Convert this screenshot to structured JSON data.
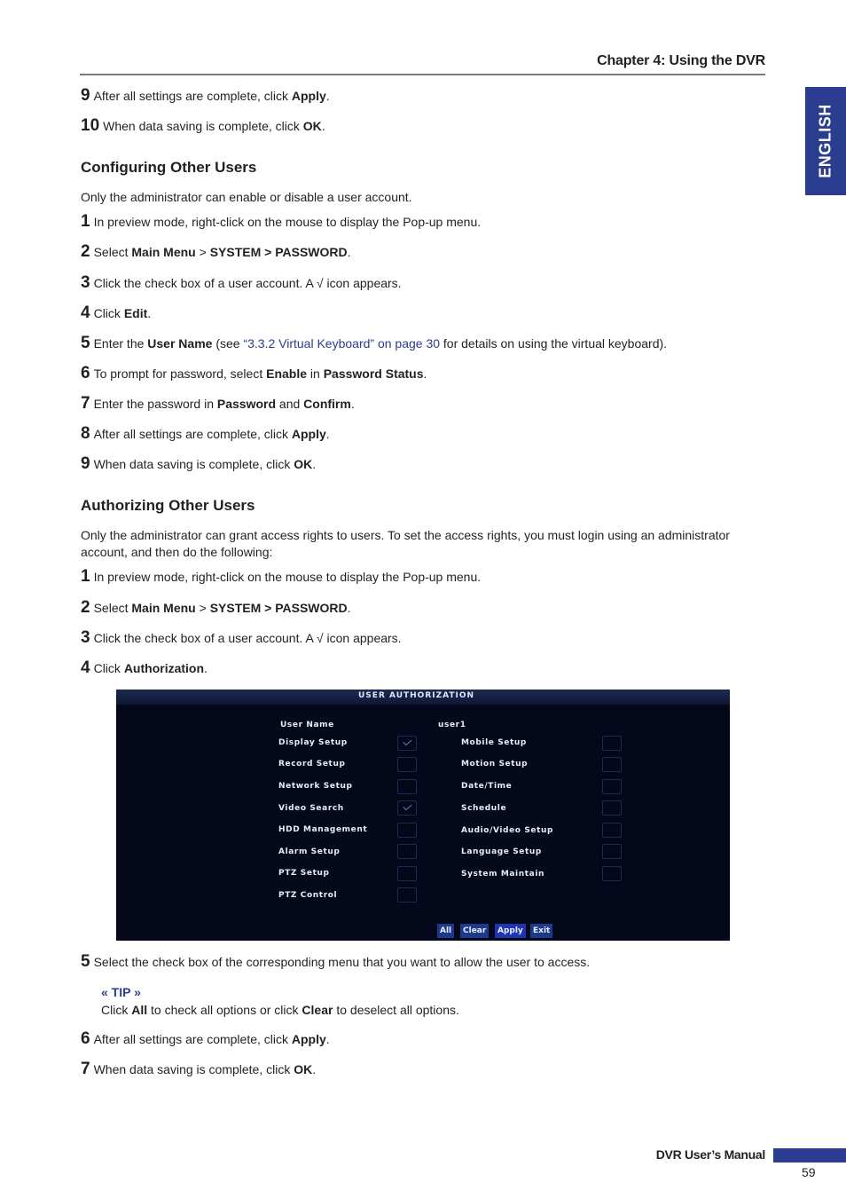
{
  "header": {
    "chapter_title": "Chapter 4: Using the DVR",
    "language_tab": "ENGLISH"
  },
  "top_steps": [
    {
      "num": "9",
      "pre": "After all settings are complete, click ",
      "bold": "Apply",
      "post": "."
    },
    {
      "num": "10",
      "pre": "When data saving is complete, click ",
      "bold": "OK",
      "post": "."
    }
  ],
  "configuring": {
    "heading": "Configuring Other Users",
    "intro": "Only the administrator can enable or disable a user account.",
    "steps": {
      "s1": {
        "num": "1",
        "text": "In preview mode, right-click on the mouse to display the Pop-up menu."
      },
      "s2": {
        "num": "2",
        "pre": "Select ",
        "b1": "Main Menu",
        "mid": " > ",
        "b2": "SYSTEM > PASSWORD",
        "post": "."
      },
      "s3": {
        "num": "3",
        "text": "Click the check box of a user account. A √ icon appears."
      },
      "s4": {
        "num": "4",
        "pre": "Click ",
        "bold": "Edit",
        "post": "."
      },
      "s5": {
        "num": "5",
        "pre": "Enter the ",
        "bold": "User Name",
        "mid": " (see ",
        "link": "“3.3.2 Virtual Keyboard” on page 30",
        "post": " for details on using the virtual keyboard)."
      },
      "s6": {
        "num": "6",
        "pre": "To prompt for password, select ",
        "b1": "Enable",
        "mid": " in ",
        "b2": "Password Status",
        "post": "."
      },
      "s7": {
        "num": "7",
        "pre": "Enter the password in ",
        "b1": "Password",
        "mid": " and ",
        "b2": "Confirm",
        "post": "."
      },
      "s8": {
        "num": "8",
        "pre": "After all settings are complete, click ",
        "bold": "Apply",
        "post": "."
      },
      "s9": {
        "num": "9",
        "pre": "When data saving is complete, click ",
        "bold": "OK",
        "post": "."
      }
    }
  },
  "authorizing": {
    "heading": "Authorizing Other Users",
    "intro": "Only the administrator can grant access rights to users. To set the access rights, you must login using an administrator account, and then do the following:",
    "steps": {
      "s1": {
        "num": "1",
        "text": "In preview mode, right-click on the mouse to display the Pop-up menu."
      },
      "s2": {
        "num": "2",
        "pre": "Select ",
        "b1": "Main Menu",
        "mid": " > ",
        "b2": "SYSTEM > PASSWORD",
        "post": "."
      },
      "s3": {
        "num": "3",
        "text": "Click the check box of a user account. A √ icon appears."
      },
      "s4": {
        "num": "4",
        "pre": "Click ",
        "bold": "Authorization",
        "post": "."
      },
      "s5": {
        "num": "5",
        "text": "Select the check box of the corresponding menu that you want to allow the user to access."
      },
      "s6": {
        "num": "6",
        "pre": "After all settings are complete, click ",
        "bold": "Apply",
        "post": "."
      },
      "s7": {
        "num": "7",
        "pre": "When data saving is complete, click ",
        "bold": "OK",
        "post": "."
      }
    },
    "tip": {
      "label": "« TIP »",
      "pre": "Click ",
      "b1": "All",
      "mid": " to check all options or click ",
      "b2": "Clear",
      "post": " to deselect all options."
    }
  },
  "dvr_screen": {
    "title": "USER  AUTHORIZATION",
    "user_name_label": "User  Name",
    "user_name_value": "user1",
    "left_options": [
      {
        "label": "Display  Setup",
        "checked": true
      },
      {
        "label": "Record  Setup",
        "checked": false
      },
      {
        "label": "Network  Setup",
        "checked": false
      },
      {
        "label": "Video  Search",
        "checked": true
      },
      {
        "label": "HDD  Management",
        "checked": false
      },
      {
        "label": "Alarm  Setup",
        "checked": false
      },
      {
        "label": "PTZ  Setup",
        "checked": false
      },
      {
        "label": "PTZ  Control",
        "checked": false
      }
    ],
    "right_options": [
      {
        "label": "Mobile  Setup",
        "checked": false
      },
      {
        "label": "Motion  Setup",
        "checked": false
      },
      {
        "label": "Date/Time",
        "checked": false
      },
      {
        "label": "Schedule",
        "checked": false
      },
      {
        "label": "Audio/Video  Setup",
        "checked": false
      },
      {
        "label": "Language  Setup",
        "checked": false
      },
      {
        "label": "System  Maintain",
        "checked": false
      }
    ],
    "buttons": {
      "all": "All",
      "clear": "Clear",
      "apply": "Apply",
      "exit": "Exit"
    }
  },
  "footer": {
    "manual_title": "DVR User’s Manual",
    "page_number": "59"
  }
}
